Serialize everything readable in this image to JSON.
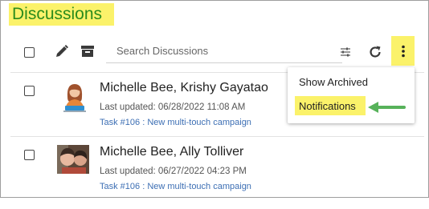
{
  "header": {
    "title": "Discussions"
  },
  "toolbar": {
    "search_placeholder": "Search Discussions",
    "icons": [
      "pencil-icon",
      "archive-icon",
      "filter-sliders-icon",
      "refresh-icon",
      "more-vertical-icon"
    ]
  },
  "discussions": [
    {
      "names": "Michelle Bee, Krishy Gayatao",
      "last_updated": "Last updated: 06/28/2022 11:08 AM",
      "task": "Task #106 : New multi-touch campaign",
      "avatar": "avatar-illustration"
    },
    {
      "names": "Michelle Bee, Ally Tolliver",
      "last_updated": "Last updated: 06/27/2022 04:23 PM",
      "task": "Task #106 : New multi-touch campaign",
      "avatar": "avatar-photo"
    }
  ],
  "menu": {
    "items": [
      {
        "label": "Show Archived"
      },
      {
        "label": "Notifications"
      }
    ]
  },
  "colors": {
    "highlight": "#fbf26a",
    "title_text": "#2a8c1c",
    "link": "#3d6fb4",
    "arrow": "#57b25a"
  }
}
